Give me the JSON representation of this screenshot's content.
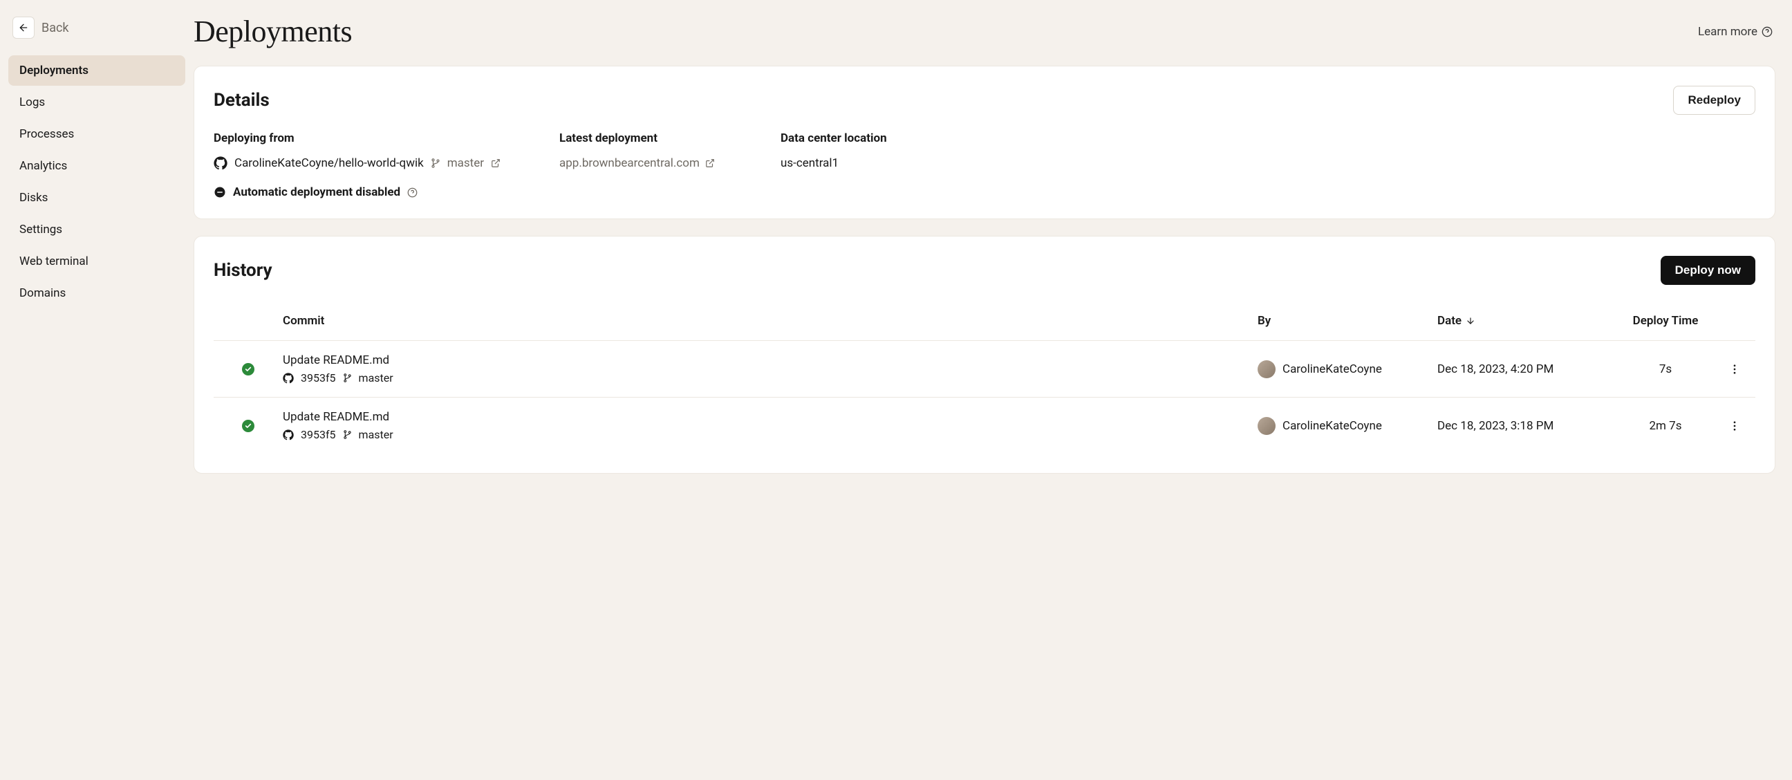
{
  "sidebar": {
    "back_label": "Back",
    "items": [
      {
        "label": "Deployments",
        "active": true
      },
      {
        "label": "Logs",
        "active": false
      },
      {
        "label": "Processes",
        "active": false
      },
      {
        "label": "Analytics",
        "active": false
      },
      {
        "label": "Disks",
        "active": false
      },
      {
        "label": "Settings",
        "active": false
      },
      {
        "label": "Web terminal",
        "active": false
      },
      {
        "label": "Domains",
        "active": false
      }
    ]
  },
  "header": {
    "title": "Deployments",
    "learn_more": "Learn more"
  },
  "details": {
    "title": "Details",
    "redeploy_label": "Redeploy",
    "deploying_from_label": "Deploying from",
    "repo_name": "CarolineKateCoyne/hello-world-qwik",
    "branch": "master",
    "auto_deploy_text": "Automatic deployment disabled",
    "latest_label": "Latest deployment",
    "latest_url": "app.brownbearcentral.com",
    "datacenter_label": "Data center location",
    "datacenter_value": "us-central1"
  },
  "history": {
    "title": "History",
    "deploy_now_label": "Deploy now",
    "columns": {
      "commit": "Commit",
      "by": "By",
      "date": "Date",
      "deploy_time": "Deploy Time"
    },
    "rows": [
      {
        "status": "success",
        "commit_msg": "Update README.md",
        "commit_hash": "3953f5",
        "branch": "master",
        "by": "CarolineKateCoyne",
        "date": "Dec 18, 2023, 4:20 PM",
        "deploy_time": "7s"
      },
      {
        "status": "success",
        "commit_msg": "Update README.md",
        "commit_hash": "3953f5",
        "branch": "master",
        "by": "CarolineKateCoyne",
        "date": "Dec 18, 2023, 3:18 PM",
        "deploy_time": "2m 7s"
      }
    ]
  }
}
